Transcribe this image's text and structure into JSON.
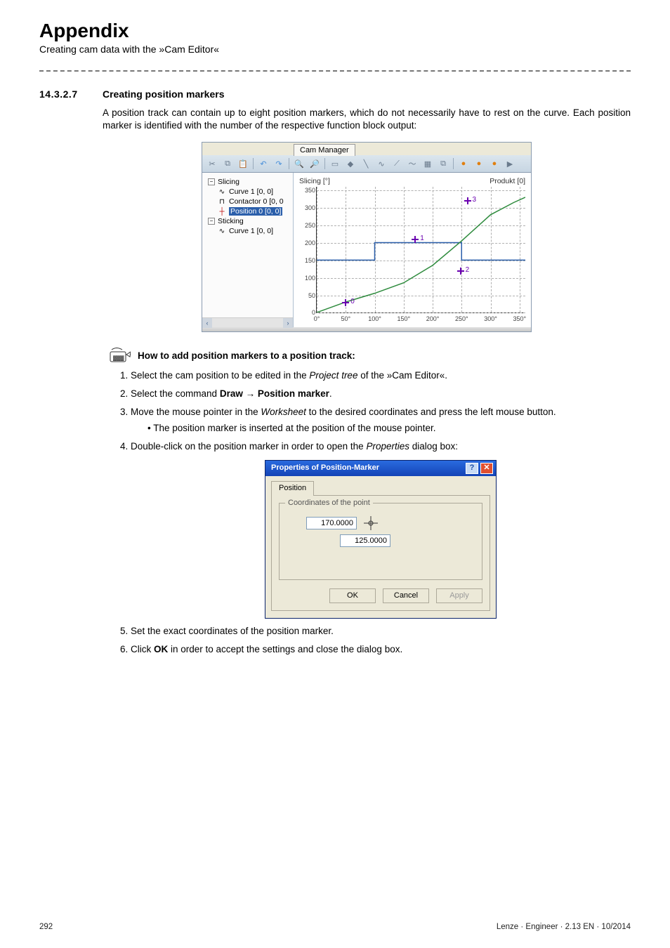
{
  "header": {
    "title": "Appendix",
    "subtitle": "Creating cam data with the »Cam Editor«"
  },
  "section": {
    "number": "14.3.2.7",
    "title": "Creating position markers",
    "intro": "A position track can contain up to eight position markers, which do not necessarily have to rest on the curve. Each position marker is identified with the number of the respective function block output:"
  },
  "cam_window": {
    "tab": "Cam Manager",
    "tree": {
      "group1": "Slicing",
      "curve1": "Curve 1 [0, 0]",
      "contactor": "Contactor 0 [0, 0",
      "position": "Position 0 [0, 0]",
      "group2": "Sticking",
      "curve2": "Curve 1 [0, 0]"
    }
  },
  "chart_data": {
    "type": "line",
    "title_left": "Slicing [°]",
    "title_right": "Produkt [0]",
    "xlabel": "",
    "ylabel": "",
    "xlim": [
      0,
      360
    ],
    "ylim": [
      0,
      360
    ],
    "x_ticks": [
      "0°",
      "50°",
      "100°",
      "150°",
      "200°",
      "250°",
      "300°",
      "350°"
    ],
    "y_ticks": [
      0,
      50,
      100,
      150,
      200,
      250,
      300,
      350
    ],
    "series": [
      {
        "name": "blue step (Slicing)",
        "color": "#2b5fab",
        "x": [
          0,
          100,
          100,
          250,
          250,
          360
        ],
        "y": [
          150,
          150,
          200,
          200,
          150,
          150
        ]
      },
      {
        "name": "green curve (Produkt)",
        "color": "#2e8b3d",
        "x": [
          0,
          50,
          100,
          150,
          200,
          250,
          280,
          300,
          340,
          360
        ],
        "y": [
          0,
          30,
          55,
          85,
          135,
          205,
          250,
          280,
          315,
          330
        ]
      }
    ],
    "position_markers": [
      {
        "id": 0,
        "x": 50,
        "y": 30
      },
      {
        "id": 1,
        "x": 170,
        "y": 210
      },
      {
        "id": 2,
        "x": 248,
        "y": 120
      },
      {
        "id": 3,
        "x": 260,
        "y": 320
      }
    ]
  },
  "howto": {
    "title": "How to add position markers to a position track:",
    "steps": {
      "s1a": "Select the cam position to be edited in the ",
      "s1b": "Project tree",
      "s1c": " of the »Cam Editor«.",
      "s2a": "Select the command ",
      "s2b": "Draw → Position marker",
      "s2c": ".",
      "s3a": "Move the mouse pointer in the ",
      "s3b": "Worksheet",
      "s3c": " to the desired coordinates and press the left mouse button.",
      "s3sub": "The position marker is inserted at the position of the mouse pointer.",
      "s4a": "Double-click on the position marker in order to open the ",
      "s4b": "Properties",
      "s4c": " dialog box:",
      "s5": "Set the exact coordinates of the position marker.",
      "s6a": "Click ",
      "s6b": "OK",
      "s6c": " in order to accept the settings and close the dialog box."
    }
  },
  "dialog": {
    "title": "Properties of Position-Marker",
    "tab": "Position",
    "group": "Coordinates of the point",
    "x_value": "170.0000",
    "y_value": "125.0000",
    "ok": "OK",
    "cancel": "Cancel",
    "apply": "Apply"
  },
  "footer": {
    "page": "292",
    "right": "Lenze · Engineer · 2.13 EN · 10/2014"
  }
}
